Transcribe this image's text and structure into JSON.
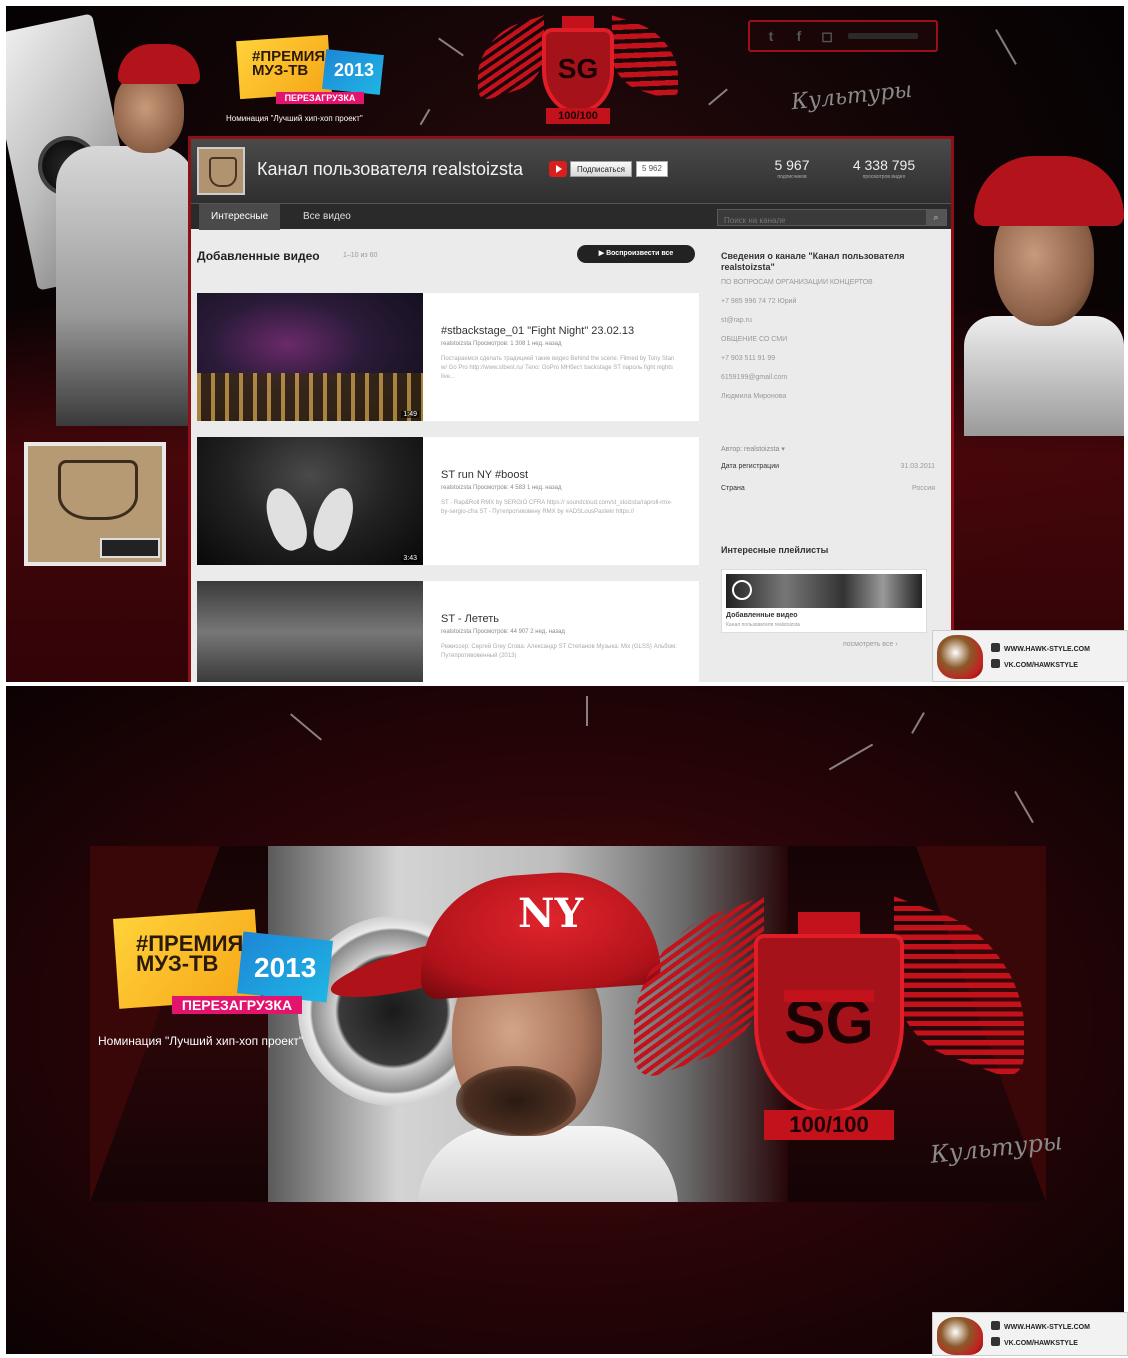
{
  "top": {
    "award": {
      "line1": "#ПРЕМИЯ",
      "line2": "МУЗ-ТВ",
      "year": "2013",
      "subtitle": "ПЕРЕЗАГРУЗКА",
      "nomination": "Номинация \"Лучший хип-хоп проект\""
    },
    "emblem": {
      "monogram": "SG",
      "ribbon": "100/100"
    },
    "script_logo": "Культуры"
  },
  "channel": {
    "title": "Канал пользователя realstoizsta",
    "subscribe_label": "Подписаться",
    "subscribe_count": "5 962",
    "stats": [
      {
        "value": "5 967",
        "label": "подписчиков"
      },
      {
        "value": "4 338 795",
        "label": "просмотров видео"
      }
    ],
    "tabs": [
      "Интересные",
      "Все видео"
    ],
    "search_placeholder": "Поиск на канале",
    "section": {
      "title": "Добавленные видео",
      "count": "1–10 из 60",
      "play_all": "Воспроизвести все"
    },
    "videos": [
      {
        "title": "#stbackstage_01 \"Fight Night\" 23.02.13",
        "meta": "realstoizsta   Просмотров: 1 308   1 нед. назад",
        "desc": "Постараемся сделать традицией такие видео Behind the scene. Filmed by Tony Stan w/ Go Pro http://www.stbest.ru/ Тело: GoPro МНбест backstage ST пароль fight nights live...",
        "duration": "1:49"
      },
      {
        "title": "ST run NY #boost",
        "meta": "realstoizsta   Просмотров: 4 583   1 нед. назад",
        "desc": "ST - Rap&Roll RMX by SERGIO CFRA https:// soundcloud.com/st_stoizsta/raproll-rmx-by-sergio-cfra ST - Путепротивовену RMX by #ADSLousPastekr https://",
        "duration": "3:43"
      },
      {
        "title": "ST - Лететь",
        "meta": "realstoizsta   Просмотров: 44 907   2 нед. назад",
        "desc": "Режиссер: Сергей Grey Сгова: Александр ST Степанов Музыка: Mix (GLSS) Альбом: Путепротивовенный (2013)",
        "duration": ""
      }
    ],
    "sidebar": {
      "about_heading": "Сведения о канале \"Канал пользователя realstoizsta\"",
      "contacts": [
        "ПО ВОПРОСАМ ОРГАНИЗАЦИИ КОНЦЕРТОВ",
        "+7 985 996 74 72 Юрий",
        "st@rap.ru",
        "ОБЩЕНИЕ СО СМИ",
        "+7 903 511 91 99",
        "6159199@gmail.com",
        "Людмила Миронова"
      ],
      "author": "Автор: realstoizsta ▾",
      "reg_label": "Дата регистрации",
      "reg_value": "31.03.2011",
      "country_label": "Страна",
      "country_value": "Россия",
      "playlists_heading": "Интересные плейлисты",
      "playlist_name": "Добавленные видео",
      "playlist_owner": "Канал пользователя realstoizsta",
      "see_all": "посмотреть все ›"
    }
  },
  "watermark": {
    "site": "WWW.HAWK-STYLE.COM",
    "vk": "VK.COM/HAWKSTYLE"
  },
  "bottom": {
    "award": {
      "line1": "#ПРЕМИЯ",
      "line2": "МУЗ-ТВ",
      "year": "2013",
      "subtitle": "ПЕРЕЗАГРУЗКА",
      "nomination": "Номинация \"Лучший хип-хоп проект\""
    },
    "cap_logo": "NY",
    "emblem": {
      "monogram": "SG",
      "ribbon": "100/100"
    },
    "script_logo": "Культуры"
  },
  "colors": {
    "accent_red": "#c3121c",
    "frame_red": "#8c1016",
    "award_yellow": "#ffd23a",
    "award_blue": "#1d86d6",
    "award_pink": "#e3146e"
  }
}
